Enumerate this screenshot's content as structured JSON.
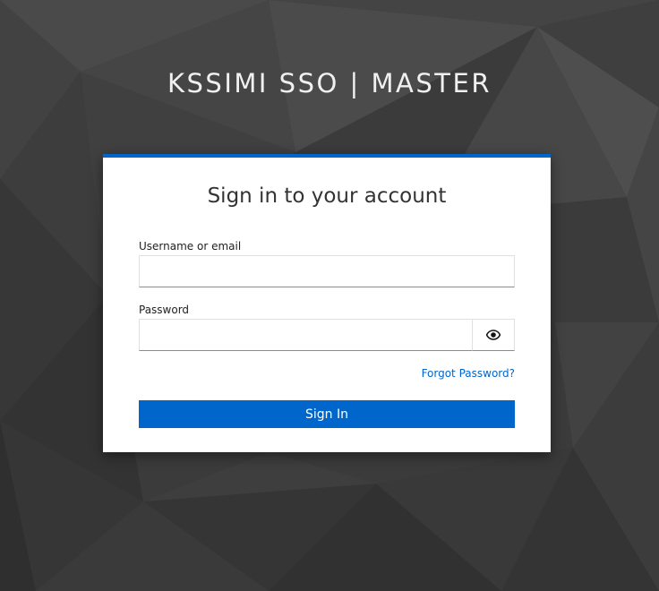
{
  "realm": {
    "title": "KSSIMI SSO | MASTER"
  },
  "login": {
    "title": "Sign in to your account",
    "username_label": "Username or email",
    "username_value": "",
    "password_label": "Password",
    "password_value": "",
    "forgot_link": "Forgot Password?",
    "submit_label": "Sign In"
  },
  "icons": {
    "password_toggle": "eye-icon"
  },
  "colors": {
    "accent": "#0066cc",
    "background": "#3a3a3a",
    "card": "#ffffff"
  }
}
